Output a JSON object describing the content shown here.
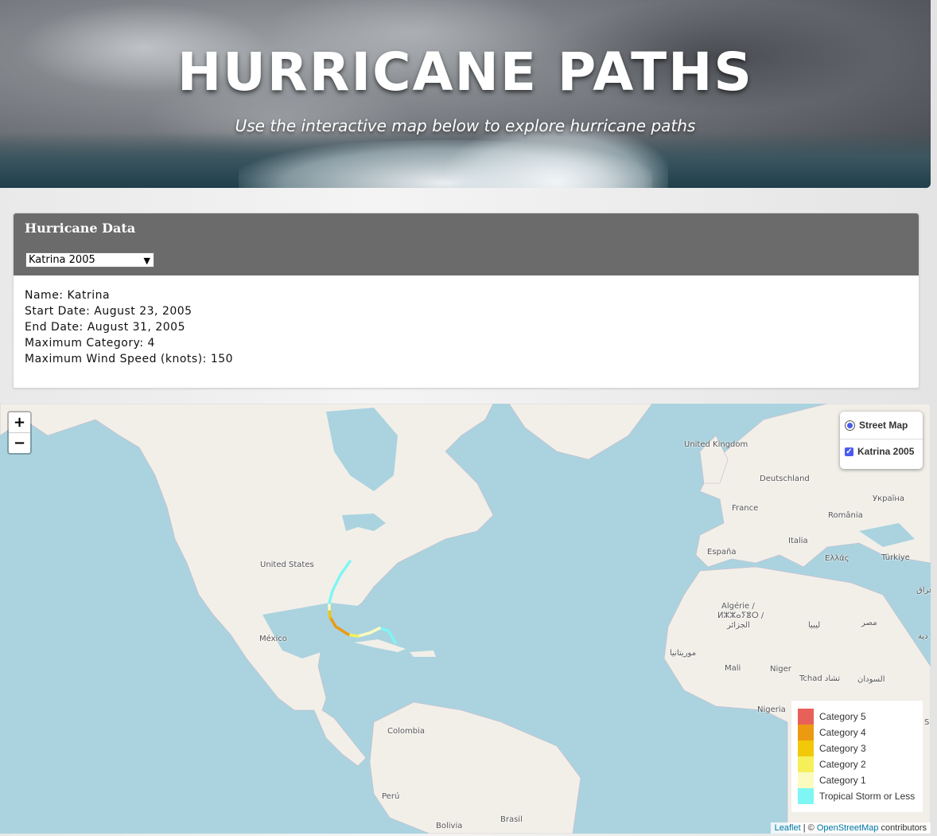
{
  "banner": {
    "title": "HURRICANE PATHS",
    "subtitle": "Use the interactive map below to explore hurricane paths"
  },
  "panel": {
    "title": "Hurricane Data",
    "selected_storm": "Katrina 2005",
    "details": [
      {
        "label": "Name:",
        "value": "Katrina"
      },
      {
        "label": "Start Date:",
        "value": "August 23, 2005"
      },
      {
        "label": "End Date:",
        "value": "August 31, 2005"
      },
      {
        "label": "Maximum Category:",
        "value": "4"
      },
      {
        "label": "Maximum Wind Speed (knots):",
        "value": "150"
      }
    ]
  },
  "map": {
    "zoom_in": "+",
    "zoom_out": "−",
    "layers": {
      "base": "Street Map",
      "overlay": "Katrina 2005"
    },
    "legend": [
      {
        "label": "Category 5",
        "color": "#e8605a"
      },
      {
        "label": "Category 4",
        "color": "#ec9a12"
      },
      {
        "label": "Category 3",
        "color": "#f2c808"
      },
      {
        "label": "Category 2",
        "color": "#f5f05a"
      },
      {
        "label": "Category 1",
        "color": "#fbfbc0"
      },
      {
        "label": "Tropical Storm or Less",
        "color": "#7ef6f4"
      }
    ],
    "place_labels": {
      "united_kingdom": "United Kingdom",
      "deutschland": "Deutschland",
      "ukraina": "Україна",
      "france": "France",
      "romania": "România",
      "espana": "España",
      "italia": "Italia",
      "ellas": "Ελλάς",
      "turkiye": "Türkiye",
      "iraq": "عراق",
      "united_states": "United States",
      "algerie_1": "Algérie /",
      "algerie_2": "ⵍⵣⵣⴰⵢⴻⵔ /",
      "algerie_3": "الجزائر",
      "libya": "ليبيا",
      "misr": "مصر",
      "arabia": "دية",
      "mexico": "México",
      "mauritania": "موريتانيا",
      "mali": "Mali",
      "niger": "Niger",
      "tchad": "Tchad تشاد",
      "sudan": "السودان",
      "nigeria": "Nigeria",
      "colombia": "Colombia",
      "peru": "Perú",
      "brasil": "Brasil",
      "bolivia": "Bolivia",
      "s_edge": "S"
    },
    "attribution": {
      "leaflet": "Leaflet",
      "sep": " | © ",
      "osm": "OpenStreetMap",
      "tail": " contributors"
    }
  }
}
